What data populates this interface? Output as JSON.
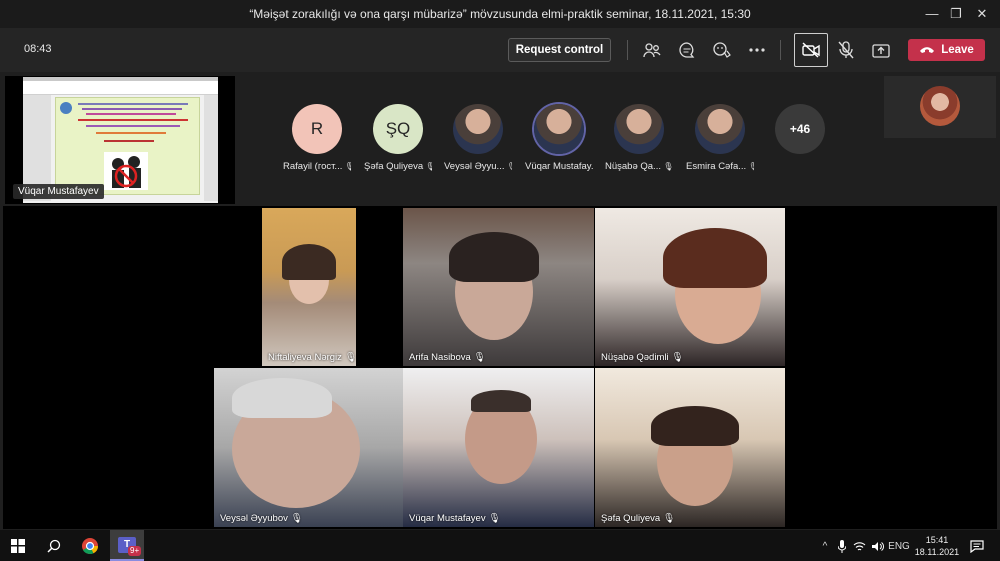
{
  "window": {
    "title": "“Məişət zorakılığı və ona qarşı mübarizə” mövzusunda elmi-praktik seminar, 18.11.2021, 15:30",
    "controls": [
      "minimize-icon",
      "restore-icon",
      "close-icon"
    ]
  },
  "toolbar": {
    "timer": "08:43",
    "request_control": "Request control",
    "leave": "Leave",
    "icons": [
      "people-icon",
      "chat-icon",
      "reactions-icon",
      "more-icon",
      "camera-off-icon",
      "mic-off-icon",
      "share-icon"
    ]
  },
  "share": {
    "presenter": "Vüqar Mustafayev"
  },
  "roster": [
    {
      "initials": "R",
      "name": "Rafayil (гост...",
      "color": "#f2c4b8",
      "muted": true
    },
    {
      "initials": "ŞQ",
      "name": "Şəfa Quliyeva",
      "color": "#d9e6c6",
      "muted": true
    },
    {
      "initials": "",
      "name": "Veysəl Əyyu...",
      "muted": true
    },
    {
      "initials": "",
      "name": "Vüqar Mustafay...",
      "muted": true,
      "active": true
    },
    {
      "initials": "",
      "name": "Nüşabə Qa...",
      "muted": true
    },
    {
      "initials": "",
      "name": "Esmira Cəfa...",
      "muted": true
    },
    {
      "initials": "+46",
      "name": "",
      "more": true
    }
  ],
  "tiles": [
    {
      "name": "Niftaliyeva Nərgiz"
    },
    {
      "name": "Arifa Nasibova"
    },
    {
      "name": "Nüşabə Qədimli"
    },
    {
      "name": "Veysəl Əyyubov"
    },
    {
      "name": "Vüqar Mustafayev"
    },
    {
      "name": "Şəfa Quliyeva"
    }
  ],
  "taskbar": {
    "lang": "ENG",
    "time": "15:41",
    "date": "18.11.2021",
    "teams_badge": "9+"
  }
}
